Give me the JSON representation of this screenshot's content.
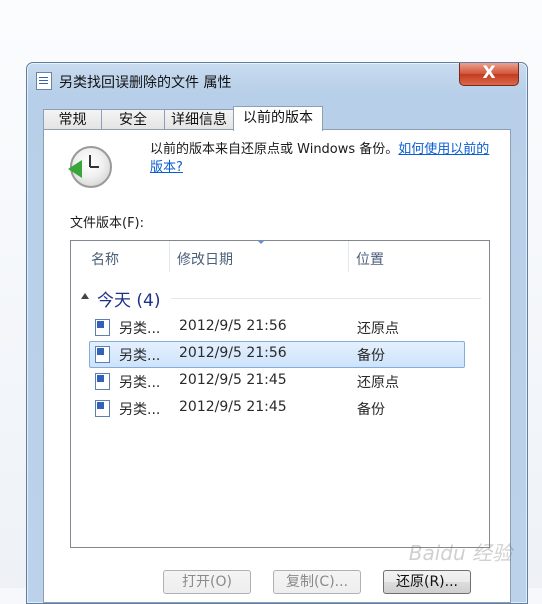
{
  "window": {
    "title": "另类找回误删除的文件 属性",
    "close_label": "X"
  },
  "tabs": [
    {
      "label": "常规",
      "active": false
    },
    {
      "label": "安全",
      "active": false
    },
    {
      "label": "详细信息",
      "active": false
    },
    {
      "label": "以前的版本",
      "active": true
    }
  ],
  "intro": {
    "text": "以前的版本来自还原点或 Windows 备份。",
    "link_text": "如何使用以前的版本?"
  },
  "versions_label": "文件版本(F):",
  "columns": {
    "name": "名称",
    "date": "修改日期",
    "location": "位置"
  },
  "group": {
    "label": "今天 (4)"
  },
  "rows": [
    {
      "name": "另类...",
      "date": "2012/9/5 21:56",
      "location": "还原点",
      "selected": false
    },
    {
      "name": "另类...",
      "date": "2012/9/5 21:56",
      "location": "备份",
      "selected": true
    },
    {
      "name": "另类...",
      "date": "2012/9/5 21:45",
      "location": "还原点",
      "selected": false
    },
    {
      "name": "另类...",
      "date": "2012/9/5 21:45",
      "location": "备份",
      "selected": false
    }
  ],
  "buttons": {
    "open": "打开(O)",
    "copy": "复制(C)...",
    "restore": "还原(R)..."
  },
  "colors": {
    "link": "#0b5ed1",
    "group_header": "#1e3287",
    "selection": "#cde3fb"
  },
  "watermark": "Baidu 经验"
}
